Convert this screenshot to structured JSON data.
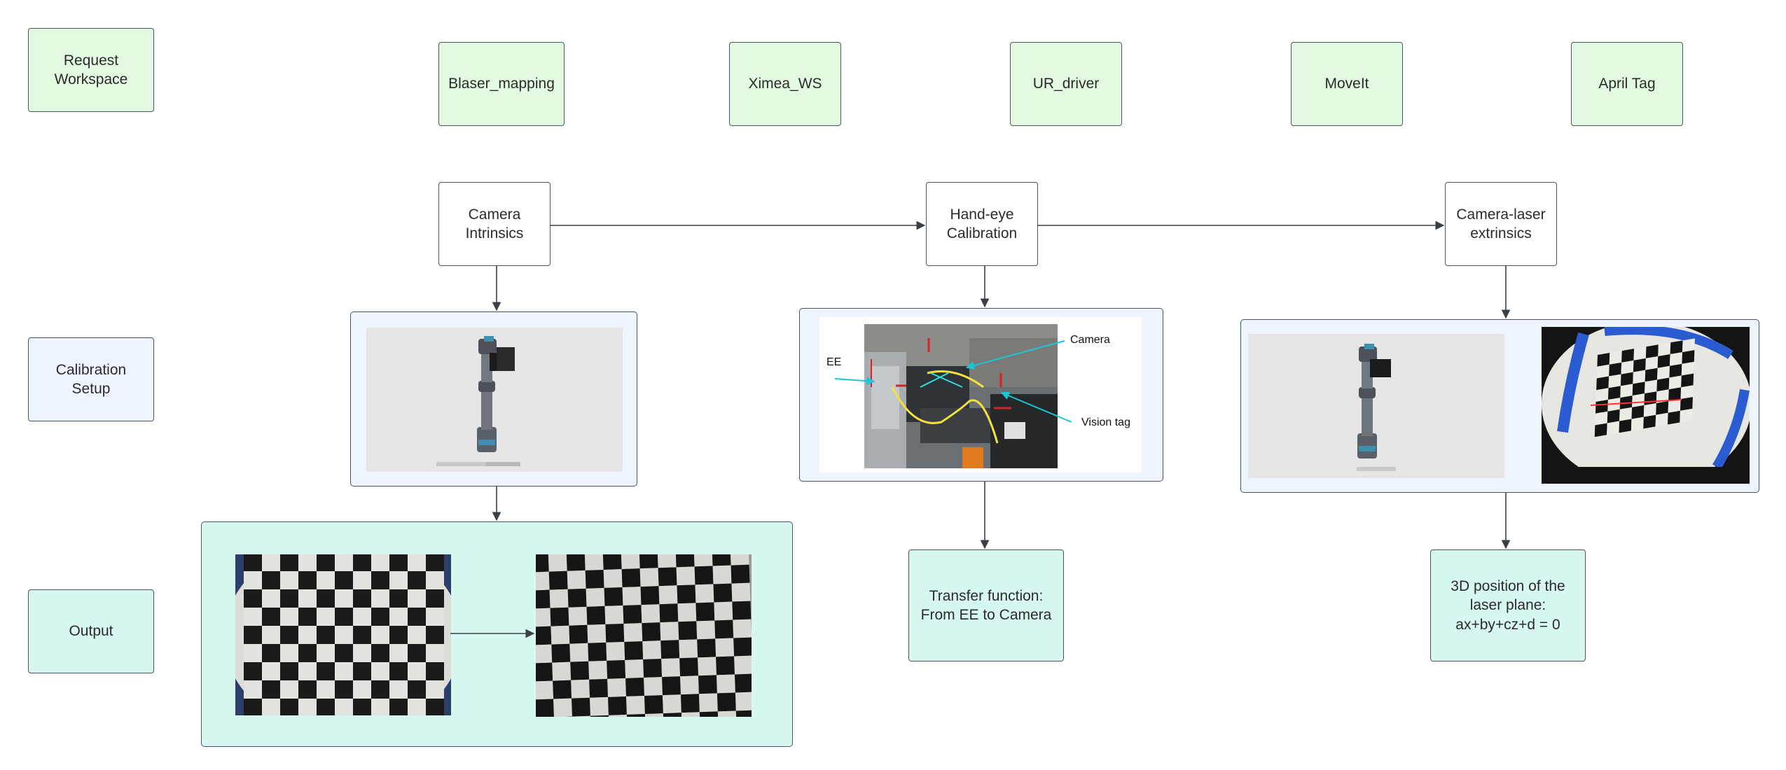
{
  "rows": {
    "request": "Request\nWorkspace",
    "setup": "Calibration\nSetup",
    "output": "Output"
  },
  "workspace": {
    "blaser": "Blaser_mapping",
    "ximea": "Ximea_WS",
    "ur": "UR_driver",
    "moveit": "MoveIt",
    "apriltag": "April Tag"
  },
  "steps": {
    "intrinsics": "Camera\nIntrinsics",
    "handeye": "Hand-eye\nCalibration",
    "extrinsics": "Camera-laser\nextrinsics"
  },
  "handeye_photo": {
    "ee": "EE",
    "camera": "Camera",
    "vision_tag": "Vision tag"
  },
  "outputs": {
    "transfer": "Transfer function:\nFrom EE to Camera",
    "plane": "3D position of the\nlaser plane:\nax+by+cz+d = 0"
  },
  "colors": {
    "workspace_fill": "#e3f9e1",
    "setup_fill": "#eef5ff",
    "output_fill": "#d6f8f0",
    "border": "#4a5560"
  }
}
